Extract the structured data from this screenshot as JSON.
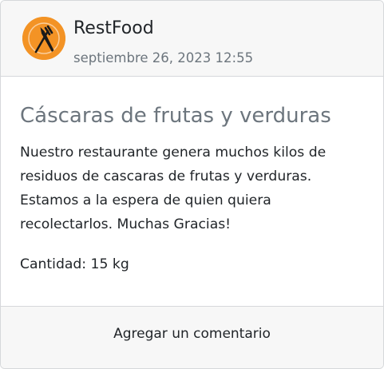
{
  "post": {
    "author": "RestFood",
    "date": "septiembre 26, 2023 12:55",
    "avatar_icon": "fork-knife-icon",
    "accent_color": "#f39325",
    "title": "Cáscaras de frutas y verduras",
    "description": "Nuestro restaurante genera muchos kilos de residuos de cascaras de frutas y verduras. Estamos a la espera de quien quiera recolectarlos. Muchas Gracias!",
    "quantity": "Cantidad: 15 kg"
  },
  "footer": {
    "comment_label": "Agregar un comentario"
  }
}
